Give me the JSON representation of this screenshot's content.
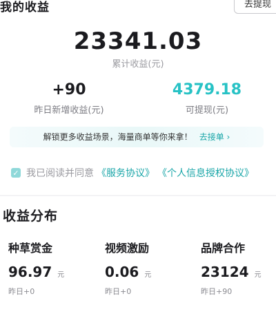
{
  "header": {
    "title": "我的收益",
    "withdraw_button": "去提现"
  },
  "summary": {
    "total_value": "23341.03",
    "total_label": "累计收益(元)",
    "yesterday_value": "+90",
    "yesterday_label": "昨日新增收益(元)",
    "withdrawable_value": "4379.18",
    "withdrawable_label": "可提现(元)"
  },
  "banner": {
    "text": "解锁更多收益场景，海量商单等你来拿！",
    "link": "去接单 ›"
  },
  "agreement": {
    "text": "我已阅读并同意",
    "service_link": "《服务协议》",
    "privacy_link": "《个人信息授权协议》"
  },
  "distribution": {
    "title": "收益分布",
    "items": [
      {
        "name": "种草赏金",
        "value": "96.97",
        "unit": "元",
        "yesterday": "昨日+0"
      },
      {
        "name": "视频激励",
        "value": "0.06",
        "unit": "元",
        "yesterday": "昨日+0"
      },
      {
        "name": "品牌合作",
        "value": "23124",
        "unit": "元",
        "yesterday": "昨日+90"
      }
    ]
  },
  "colors": {
    "accent_teal": "#27c2c5",
    "link_teal": "#1aa6a8"
  }
}
